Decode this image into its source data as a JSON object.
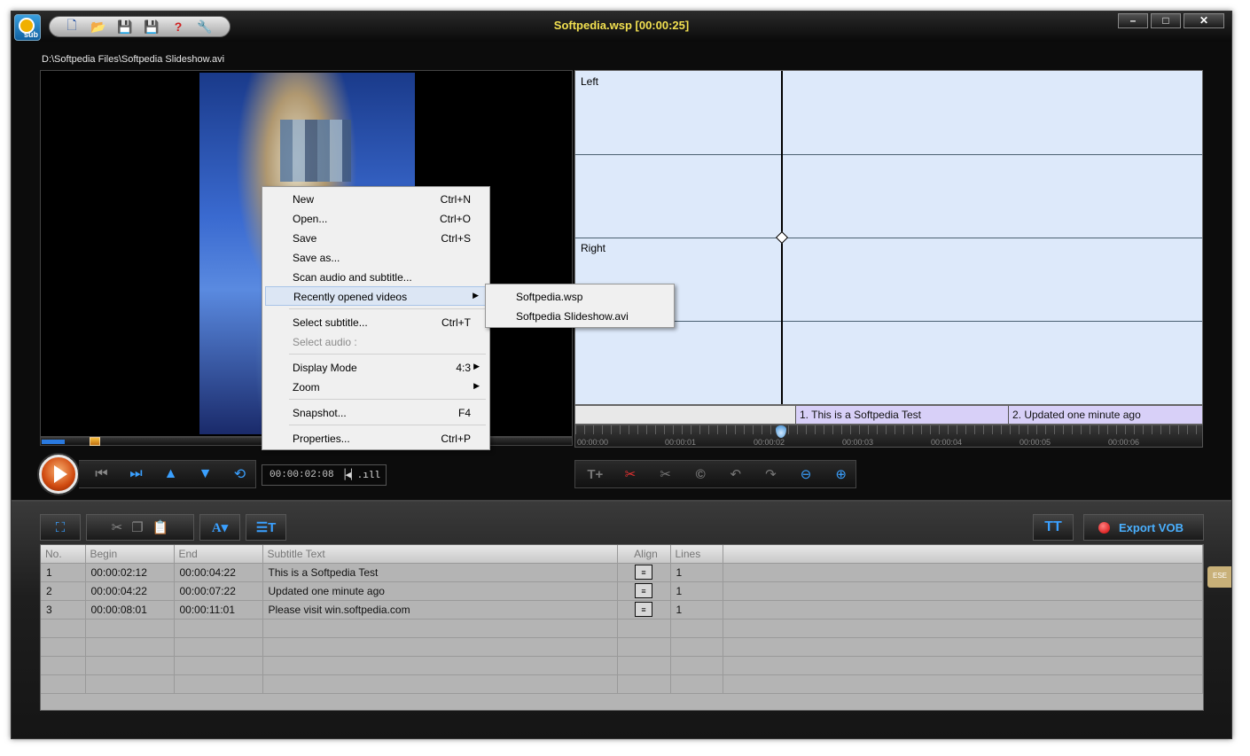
{
  "window": {
    "title": "Softpedia.wsp [00:00:25]",
    "file_path": "D:\\Softpedia Files\\Softpedia Slideshow.avi",
    "logo_text": "sub",
    "controls": [
      "–",
      "□",
      "✕"
    ]
  },
  "quickbar": {
    "icons": [
      "new-file-icon",
      "open-folder-icon",
      "save-icon",
      "save-as-icon",
      "help-icon",
      "settings-icon"
    ]
  },
  "transport": {
    "timecode": "00:00:02:08",
    "volume": "▕◀▏.ıll"
  },
  "waveform": {
    "left_label": "Left",
    "right_label": "Right",
    "segments": [
      {
        "label": "1. This is a Softpedia Test"
      },
      {
        "label": "2. Updated one minute ago"
      }
    ],
    "ticks": [
      "00:00:00",
      "00:00:01",
      "00:00:02",
      "00:00:03",
      "00:00:04",
      "00:00:05",
      "00:00:06"
    ]
  },
  "lower_toolbar": {
    "export_label": "Export VOB"
  },
  "table": {
    "columns": [
      "No.",
      "Begin",
      "End",
      "Subtitle Text",
      "Align",
      "Lines"
    ],
    "rows": [
      {
        "no": "1",
        "begin": "00:00:02:12",
        "end": "00:00:04:22",
        "text": "This is a Softpedia Test",
        "lines": "1"
      },
      {
        "no": "2",
        "begin": "00:00:04:22",
        "end": "00:00:07:22",
        "text": "Updated one minute ago",
        "lines": "1"
      },
      {
        "no": "3",
        "begin": "00:00:08:01",
        "end": "00:00:11:01",
        "text": "Please visit win.softpedia.com",
        "lines": "1"
      }
    ]
  },
  "context_menu": {
    "items": [
      {
        "label": "New",
        "shortcut": "Ctrl+N"
      },
      {
        "label": "Open...",
        "shortcut": "Ctrl+O"
      },
      {
        "label": "Save",
        "shortcut": "Ctrl+S"
      },
      {
        "label": "Save as...",
        "shortcut": ""
      },
      {
        "label": "Scan audio and subtitle...",
        "shortcut": ""
      },
      {
        "label": "Recently opened videos",
        "shortcut": ""
      },
      {
        "label": "Select subtitle...",
        "shortcut": "Ctrl+T"
      },
      {
        "label": "Select audio :",
        "shortcut": ""
      },
      {
        "label": "Display Mode",
        "shortcut": "4:3"
      },
      {
        "label": "Zoom",
        "shortcut": ""
      },
      {
        "label": "Snapshot...",
        "shortcut": "F4"
      },
      {
        "label": "Properties...",
        "shortcut": "Ctrl+P"
      }
    ],
    "submenu": [
      "Softpedia.wsp",
      "Softpedia Slideshow.avi"
    ]
  },
  "side_stub": "ESE",
  "colors": {
    "title_text": "#f2e050",
    "accent_blue": "#3aa0ff",
    "waveform_bg": "#dde9fa",
    "segment_bg": "#d8d0f8",
    "table_bg": "#b4b4b4"
  }
}
